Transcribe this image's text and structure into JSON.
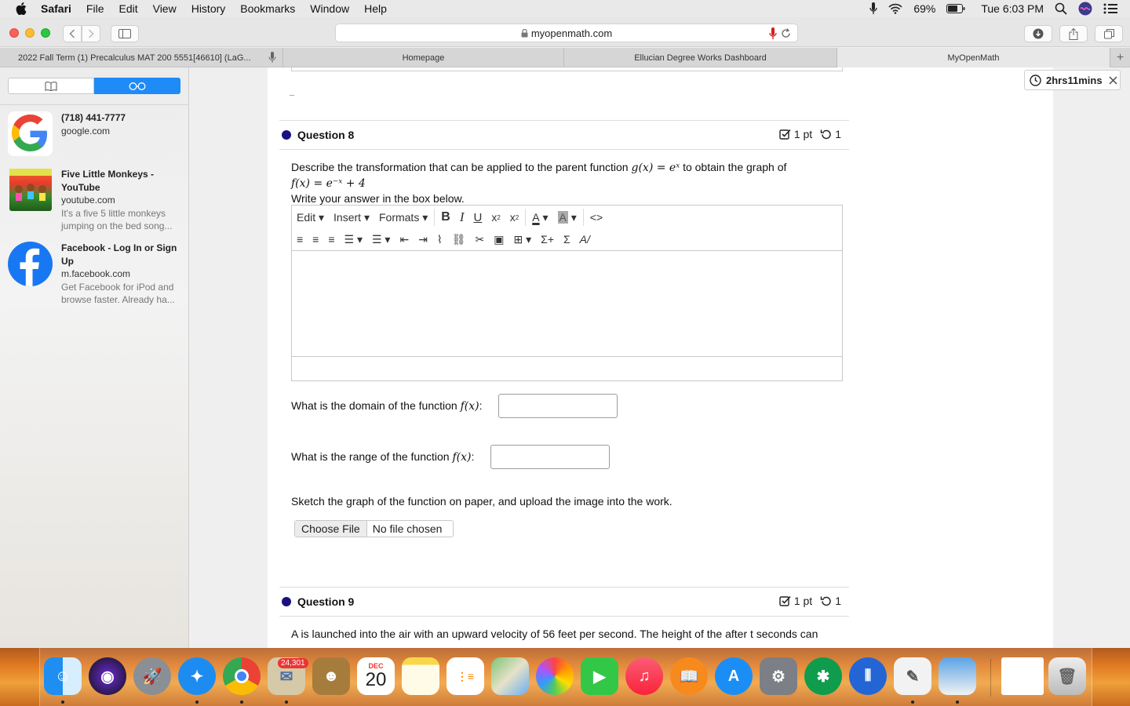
{
  "menubar": {
    "app": "Safari",
    "items": [
      "File",
      "Edit",
      "View",
      "History",
      "Bookmarks",
      "Window",
      "Help"
    ],
    "battery": "69%",
    "clock": "Tue 6:03 PM"
  },
  "toolbar": {
    "url": "myopenmath.com"
  },
  "tabs": [
    {
      "label": "2022 Fall Term (1) Precalculus MAT 200 5551[46610] (LaG..."
    },
    {
      "label": "Homepage"
    },
    {
      "label": "Ellucian Degree Works Dashboard"
    },
    {
      "label": "MyOpenMath"
    }
  ],
  "sidebar": {
    "items": [
      {
        "title": "(718) 441-7777",
        "url": "google.com",
        "desc": "",
        "icon": "google-icon"
      },
      {
        "title": "Five Little Monkeys - YouTube",
        "url": "youtube.com",
        "desc": "It's a five 5 little monkeys jumping on the bed song...",
        "icon": "youtube-thumbnail"
      },
      {
        "title": "Facebook - Log In or Sign Up",
        "url": "m.facebook.com",
        "desc": "Get Facebook for iPod and browse faster. Already ha...",
        "icon": "facebook-icon"
      }
    ]
  },
  "timer": {
    "label": "2hrs11mins"
  },
  "question8": {
    "title": "Question 8",
    "points": "1 pt",
    "attempts": "1",
    "prompt_pre": "Describe the transformation that can be applied to the parent function",
    "parent_fn": "g(x) = eˣ",
    "prompt_mid": "to obtain the graph of",
    "target_fn": "f(x) = e⁻ˣ + 4",
    "instruction": "Write your answer in the box below.",
    "editor": {
      "menus": [
        "Edit",
        "Insert",
        "Formats"
      ]
    },
    "domain_label": "What is the domain of the function",
    "range_label": "What is the range of the function",
    "fx": "f(x)",
    "colon": ":",
    "sketch_text": "Sketch the graph of the function on paper, and upload the image into the work.",
    "choose_file": "Choose File",
    "no_file": "No file chosen"
  },
  "question9": {
    "title": "Question 9",
    "points": "1 pt",
    "attempts": "1",
    "prompt": "A is launched into the air with an upward velocity of 56 feet per second. The height of the after t seconds can"
  },
  "dock": {
    "calendar_month": "DEC",
    "calendar_day": "20",
    "mail_badge": "24,301"
  }
}
